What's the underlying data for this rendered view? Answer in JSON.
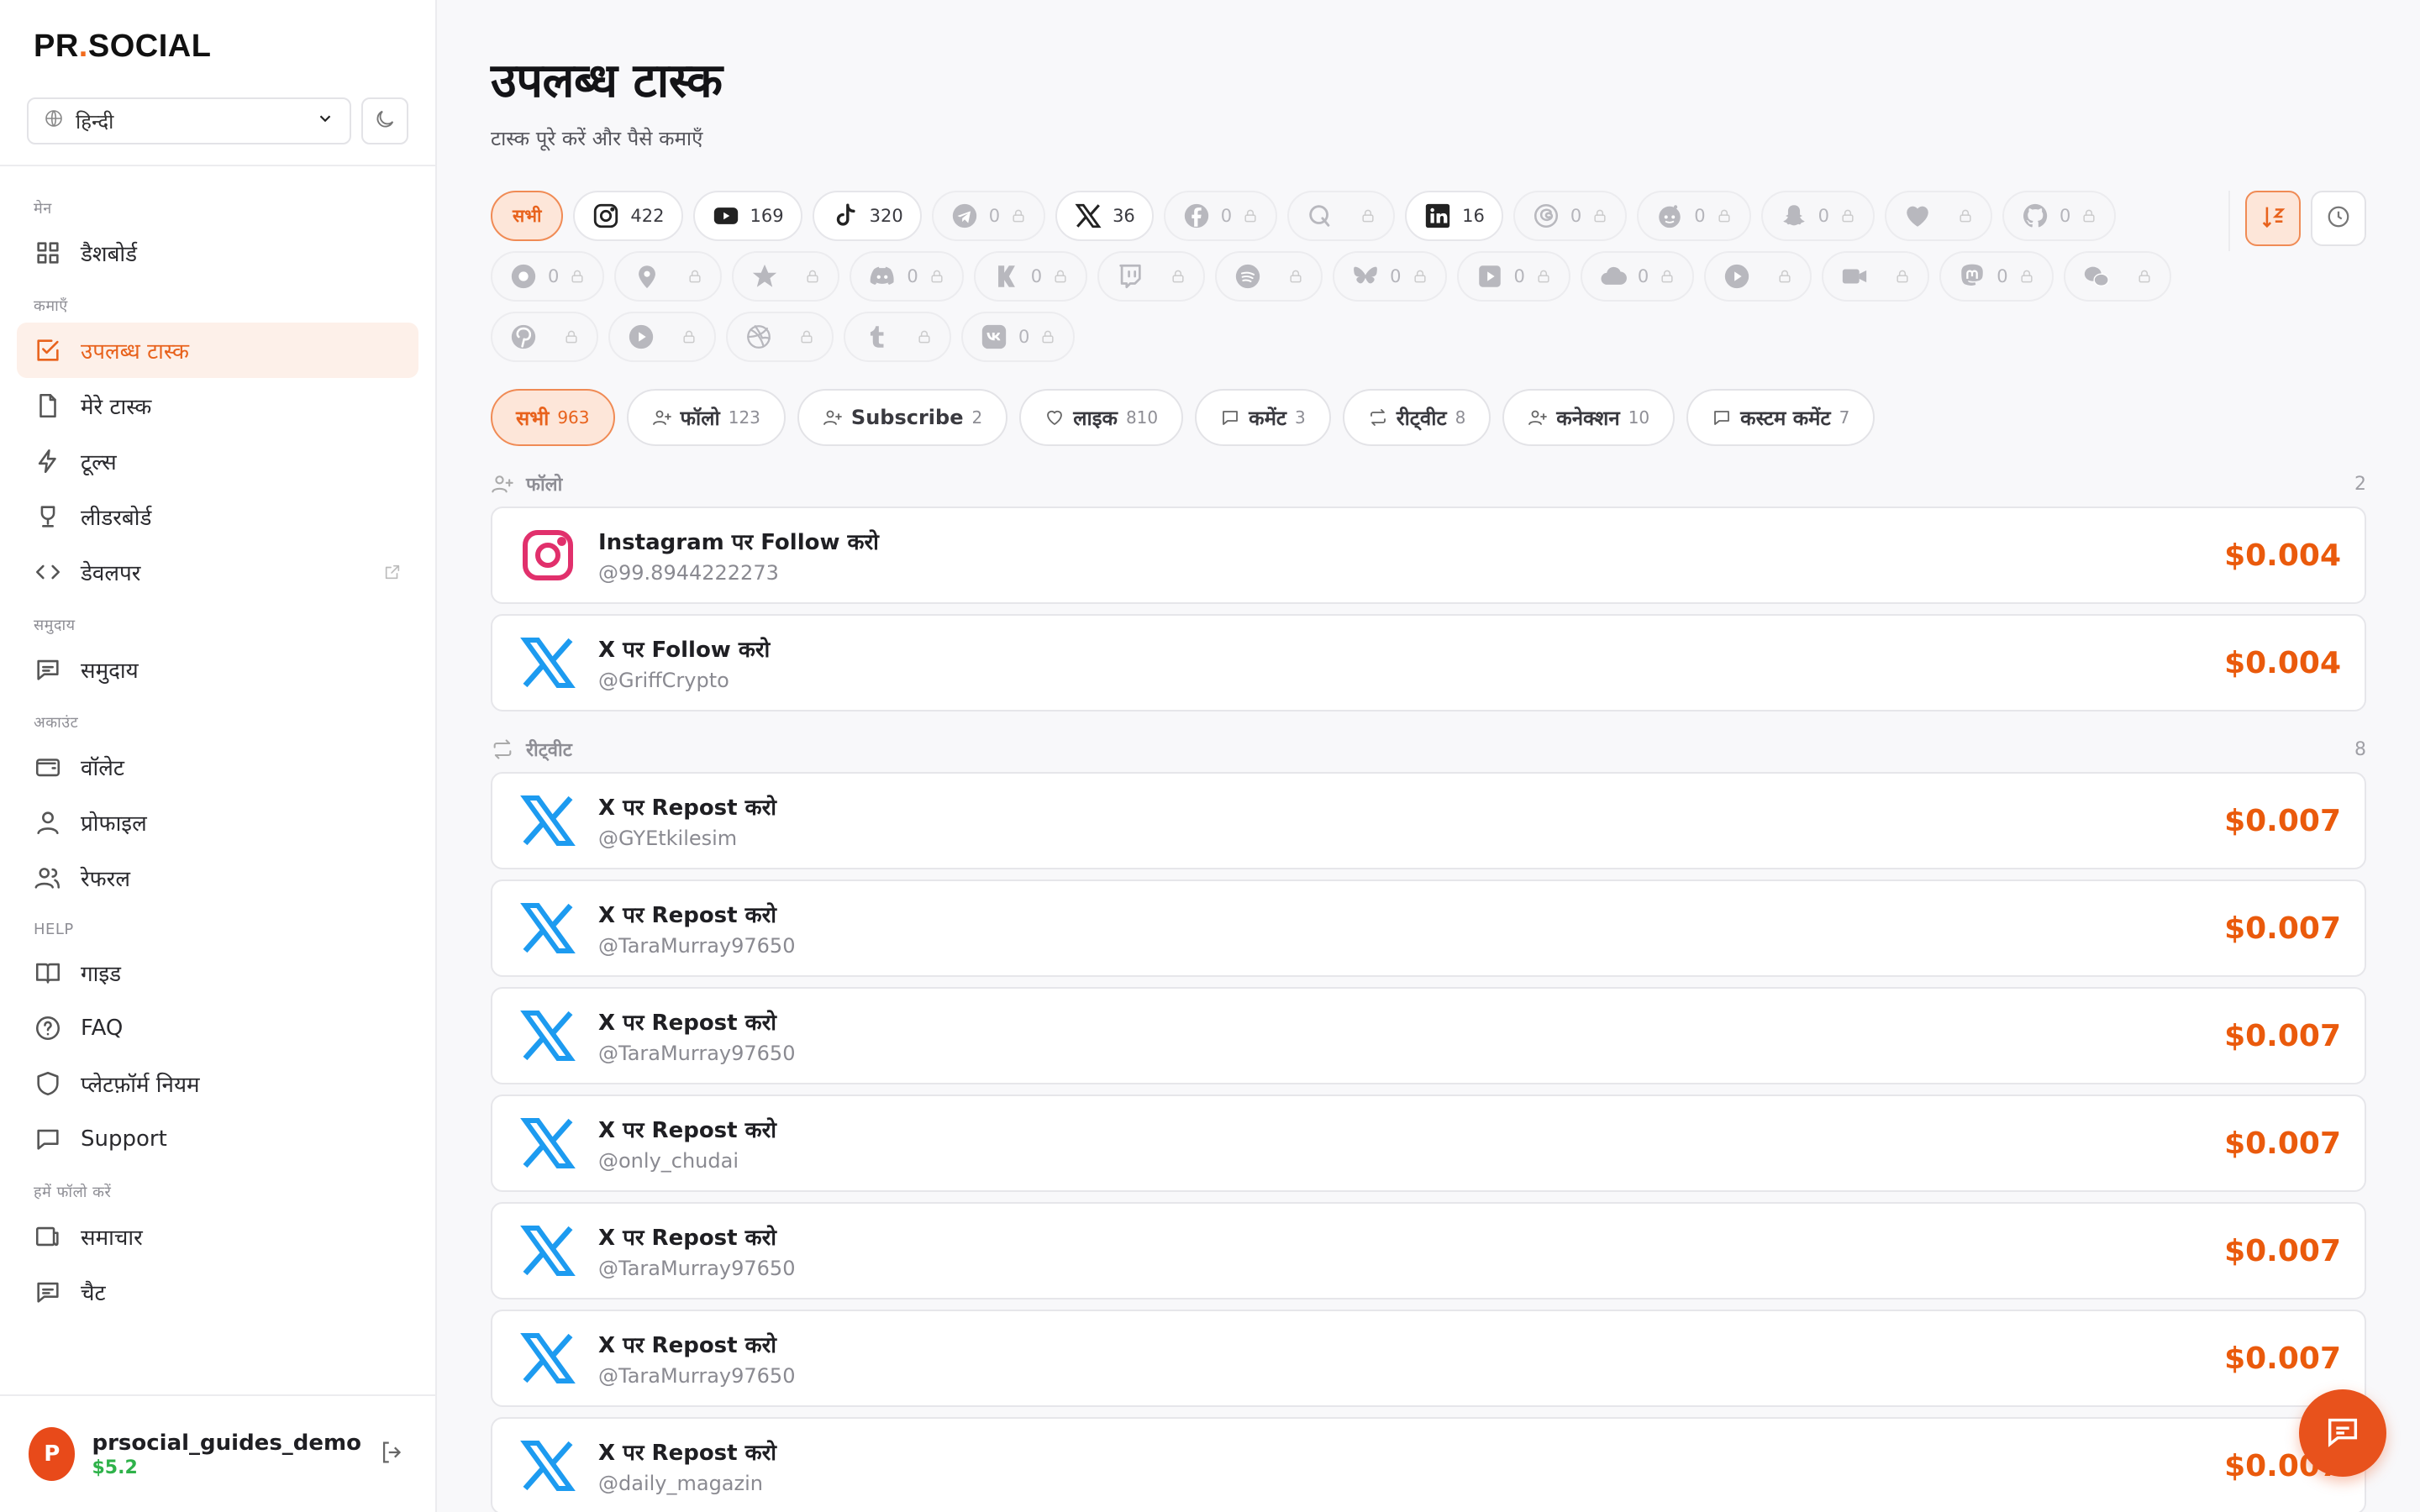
{
  "brand": {
    "left": "PR",
    "dot": ".",
    "right": "SOCIAL"
  },
  "language": {
    "selected": "हिन्दी"
  },
  "sidebar": {
    "sections": [
      {
        "label": "मेन",
        "items": [
          {
            "label": "डैशबोर्ड",
            "icon": "grid-icon"
          }
        ]
      },
      {
        "label": "कमाएँ",
        "items": [
          {
            "label": "उपलब्ध टास्क",
            "icon": "checkbox-icon",
            "active": true
          },
          {
            "label": "मेरे टास्क",
            "icon": "file-icon"
          },
          {
            "label": "टूल्स",
            "icon": "bolt-icon"
          },
          {
            "label": "लीडरबोर्ड",
            "icon": "trophy-icon"
          },
          {
            "label": "डेवलपर",
            "icon": "code-icon",
            "external": true
          }
        ]
      },
      {
        "label": "समुदाय",
        "items": [
          {
            "label": "समुदाय",
            "icon": "message-icon"
          }
        ]
      },
      {
        "label": "अकाउंट",
        "items": [
          {
            "label": "वॉलेट",
            "icon": "wallet-icon"
          },
          {
            "label": "प्रोफाइल",
            "icon": "user-icon"
          },
          {
            "label": "रेफरल",
            "icon": "users-icon"
          }
        ]
      },
      {
        "label": "HELP",
        "items": [
          {
            "label": "गाइड",
            "icon": "book-icon"
          },
          {
            "label": "FAQ",
            "icon": "question-icon"
          },
          {
            "label": "प्लेटफ़ॉर्म नियम",
            "icon": "shield-icon"
          },
          {
            "label": "Support",
            "icon": "chat-icon"
          }
        ]
      },
      {
        "label": "हमें फॉलो करें",
        "items": [
          {
            "label": "समाचार",
            "icon": "news-icon"
          },
          {
            "label": "चैट",
            "icon": "message-icon"
          }
        ]
      }
    ]
  },
  "user": {
    "initial": "P",
    "name": "prsocial_guides_demo",
    "balance": "$5.2"
  },
  "page": {
    "title": "उपलब्ध टास्क",
    "subtitle": "टास्क पूरे करें और पैसे कमाएँ"
  },
  "platforms": [
    {
      "label": "सभी",
      "active": true
    },
    {
      "icon": "instagram-icon",
      "count": "422",
      "locked": false
    },
    {
      "icon": "youtube-icon",
      "count": "169",
      "locked": false
    },
    {
      "icon": "tiktok-icon",
      "count": "320",
      "locked": false
    },
    {
      "icon": "telegram-icon",
      "count": "0",
      "locked": true
    },
    {
      "icon": "x-icon",
      "count": "36",
      "locked": false
    },
    {
      "icon": "facebook-icon",
      "count": "0",
      "locked": true
    },
    {
      "icon": "quora-icon",
      "count": "",
      "locked": true
    },
    {
      "icon": "linkedin-icon",
      "count": "16",
      "locked": false
    },
    {
      "icon": "threads-icon",
      "count": "0",
      "locked": true
    },
    {
      "icon": "reddit-icon",
      "count": "0",
      "locked": true
    },
    {
      "icon": "snapchat-icon",
      "count": "0",
      "locked": true
    },
    {
      "icon": "heart-icon",
      "count": "",
      "locked": true
    },
    {
      "icon": "github-icon",
      "count": "0",
      "locked": true
    },
    {
      "icon": "circle-dot-icon",
      "count": "0",
      "locked": true
    },
    {
      "icon": "map-pin-icon",
      "count": "",
      "locked": true
    },
    {
      "icon": "star-icon",
      "count": "",
      "locked": true
    },
    {
      "icon": "discord-icon",
      "count": "0",
      "locked": true
    },
    {
      "icon": "kick-icon",
      "count": "0",
      "locked": true
    },
    {
      "icon": "twitch-icon",
      "count": "",
      "locked": true
    },
    {
      "icon": "spotify-icon",
      "count": "",
      "locked": true
    },
    {
      "icon": "bluesky-icon",
      "count": "0",
      "locked": true
    },
    {
      "icon": "play-square-icon",
      "count": "0",
      "locked": true
    },
    {
      "icon": "cloud-icon",
      "count": "0",
      "locked": true
    },
    {
      "icon": "play-circle-icon",
      "count": "",
      "locked": true
    },
    {
      "icon": "video-icon",
      "count": "",
      "locked": true
    },
    {
      "icon": "mastodon-icon",
      "count": "0",
      "locked": true
    },
    {
      "icon": "wechat-icon",
      "count": "",
      "locked": true
    },
    {
      "icon": "pinterest-icon",
      "count": "",
      "locked": true
    },
    {
      "icon": "play-circle-2-icon",
      "count": "",
      "locked": true
    },
    {
      "icon": "dribbble-icon",
      "count": "",
      "locked": true
    },
    {
      "icon": "tumblr-icon",
      "count": "",
      "locked": true
    },
    {
      "icon": "vk-icon",
      "count": "0",
      "locked": true
    }
  ],
  "tools": [
    {
      "icon": "sort-icon",
      "active": true
    },
    {
      "icon": "clock-icon",
      "active": false
    }
  ],
  "types": [
    {
      "label": "सभी",
      "count": "963",
      "icon": "",
      "active": true
    },
    {
      "label": "फॉलो",
      "count": "123",
      "icon": "user-plus-icon"
    },
    {
      "label": "Subscribe",
      "count": "2",
      "icon": "user-plus-icon"
    },
    {
      "label": "लाइक",
      "count": "810",
      "icon": "heart-outline-icon"
    },
    {
      "label": "कमेंट",
      "count": "3",
      "icon": "comment-icon"
    },
    {
      "label": "रीट्वीट",
      "count": "8",
      "icon": "repeat-icon"
    },
    {
      "label": "कनेक्शन",
      "count": "10",
      "icon": "user-plus-icon"
    },
    {
      "label": "कस्टम कमेंट",
      "count": "7",
      "icon": "comment-icon"
    }
  ],
  "groups": [
    {
      "label": "फॉलो",
      "icon": "user-plus-icon",
      "count": "2",
      "tasks": [
        {
          "platform": "instagram",
          "title": "Instagram पर Follow करो",
          "handle": "@99.8944222273",
          "price": "$0.004"
        },
        {
          "platform": "x",
          "title": "X पर Follow करो",
          "handle": "@GriffCrypto",
          "price": "$0.004"
        }
      ]
    },
    {
      "label": "रीट्वीट",
      "icon": "repeat-icon",
      "count": "8",
      "tasks": [
        {
          "platform": "x",
          "title": "X पर Repost करो",
          "handle": "@GYEtkilesim",
          "price": "$0.007"
        },
        {
          "platform": "x",
          "title": "X पर Repost करो",
          "handle": "@TaraMurray97650",
          "price": "$0.007"
        },
        {
          "platform": "x",
          "title": "X पर Repost करो",
          "handle": "@TaraMurray97650",
          "price": "$0.007"
        },
        {
          "platform": "x",
          "title": "X पर Repost करो",
          "handle": "@only_chudai",
          "price": "$0.007"
        },
        {
          "platform": "x",
          "title": "X पर Repost करो",
          "handle": "@TaraMurray97650",
          "price": "$0.007"
        },
        {
          "platform": "x",
          "title": "X पर Repost करो",
          "handle": "@TaraMurray97650",
          "price": "$0.007"
        },
        {
          "platform": "x",
          "title": "X पर Repost करो",
          "handle": "@daily_magazin",
          "price": "$0.007"
        }
      ]
    }
  ],
  "colors": {
    "accent": "#e8621c",
    "price": "#ea5a0c",
    "x_blue": "#1d9bf0",
    "instagram": "#e1306c",
    "balance": "#2fb24a"
  }
}
